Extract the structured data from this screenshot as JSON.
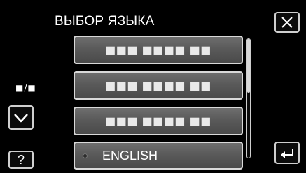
{
  "header": {
    "title": "ВЫБОР ЯЗЫКА"
  },
  "icons": {
    "close": "close-icon",
    "down": "chevron-down-icon",
    "help": "help-icon",
    "back": "back-arrow-icon"
  },
  "help": {
    "label": "?"
  },
  "pager": {
    "indicator": "■/■"
  },
  "languages": [
    {
      "label": "■■■ ■■■■ ■■",
      "selected": false
    },
    {
      "label": "■■■ ■■■■ ■■",
      "selected": false
    },
    {
      "label": "■■■ ■■■■ ■■",
      "selected": false
    },
    {
      "label": "ENGLISH",
      "selected": true
    }
  ],
  "scroll": {
    "position_fraction": 0.0,
    "visible_fraction": 0.45
  },
  "colors": {
    "background": "#000000",
    "item_gray": "#5a5a5a",
    "border": "#d9d9d9",
    "text": "#ffffff"
  }
}
